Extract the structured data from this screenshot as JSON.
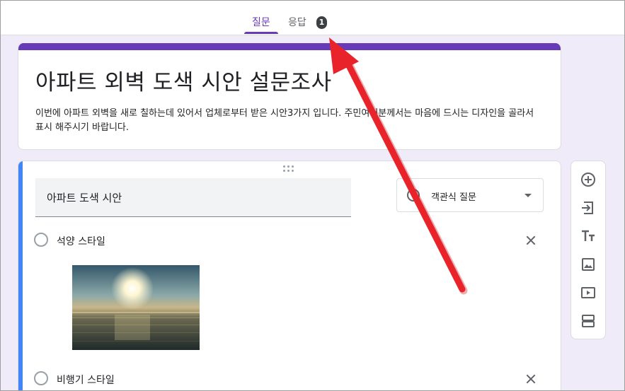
{
  "tabs": [
    {
      "label": "질문",
      "active": true
    },
    {
      "label": "응답",
      "active": false,
      "badge": "1"
    }
  ],
  "form": {
    "title": "아파트 외벽 도색 시안 설문조사",
    "description": "이번에 아파트 외벽을 새로 칠하는데 있어서 업체로부터 받은 시안3가지 입니다. 주민여러분께서는 마음에 드시는 디자인을 골라서 표시 해주시기 바랍니다."
  },
  "question": {
    "title": "아파트 도색 시안",
    "type_label": "객관식 질문",
    "options": [
      {
        "label": "석양 스타일"
      },
      {
        "label": "비행기 스타일"
      }
    ]
  },
  "toolbar": {
    "items": [
      "add-question-icon",
      "import-questions-icon",
      "add-title-icon",
      "add-image-icon",
      "add-video-icon",
      "add-section-icon"
    ]
  },
  "colors": {
    "accent": "#673ab7",
    "question_highlight": "#4285f4",
    "annotation_arrow": "#e8242a",
    "background": "#f0ebf8"
  }
}
